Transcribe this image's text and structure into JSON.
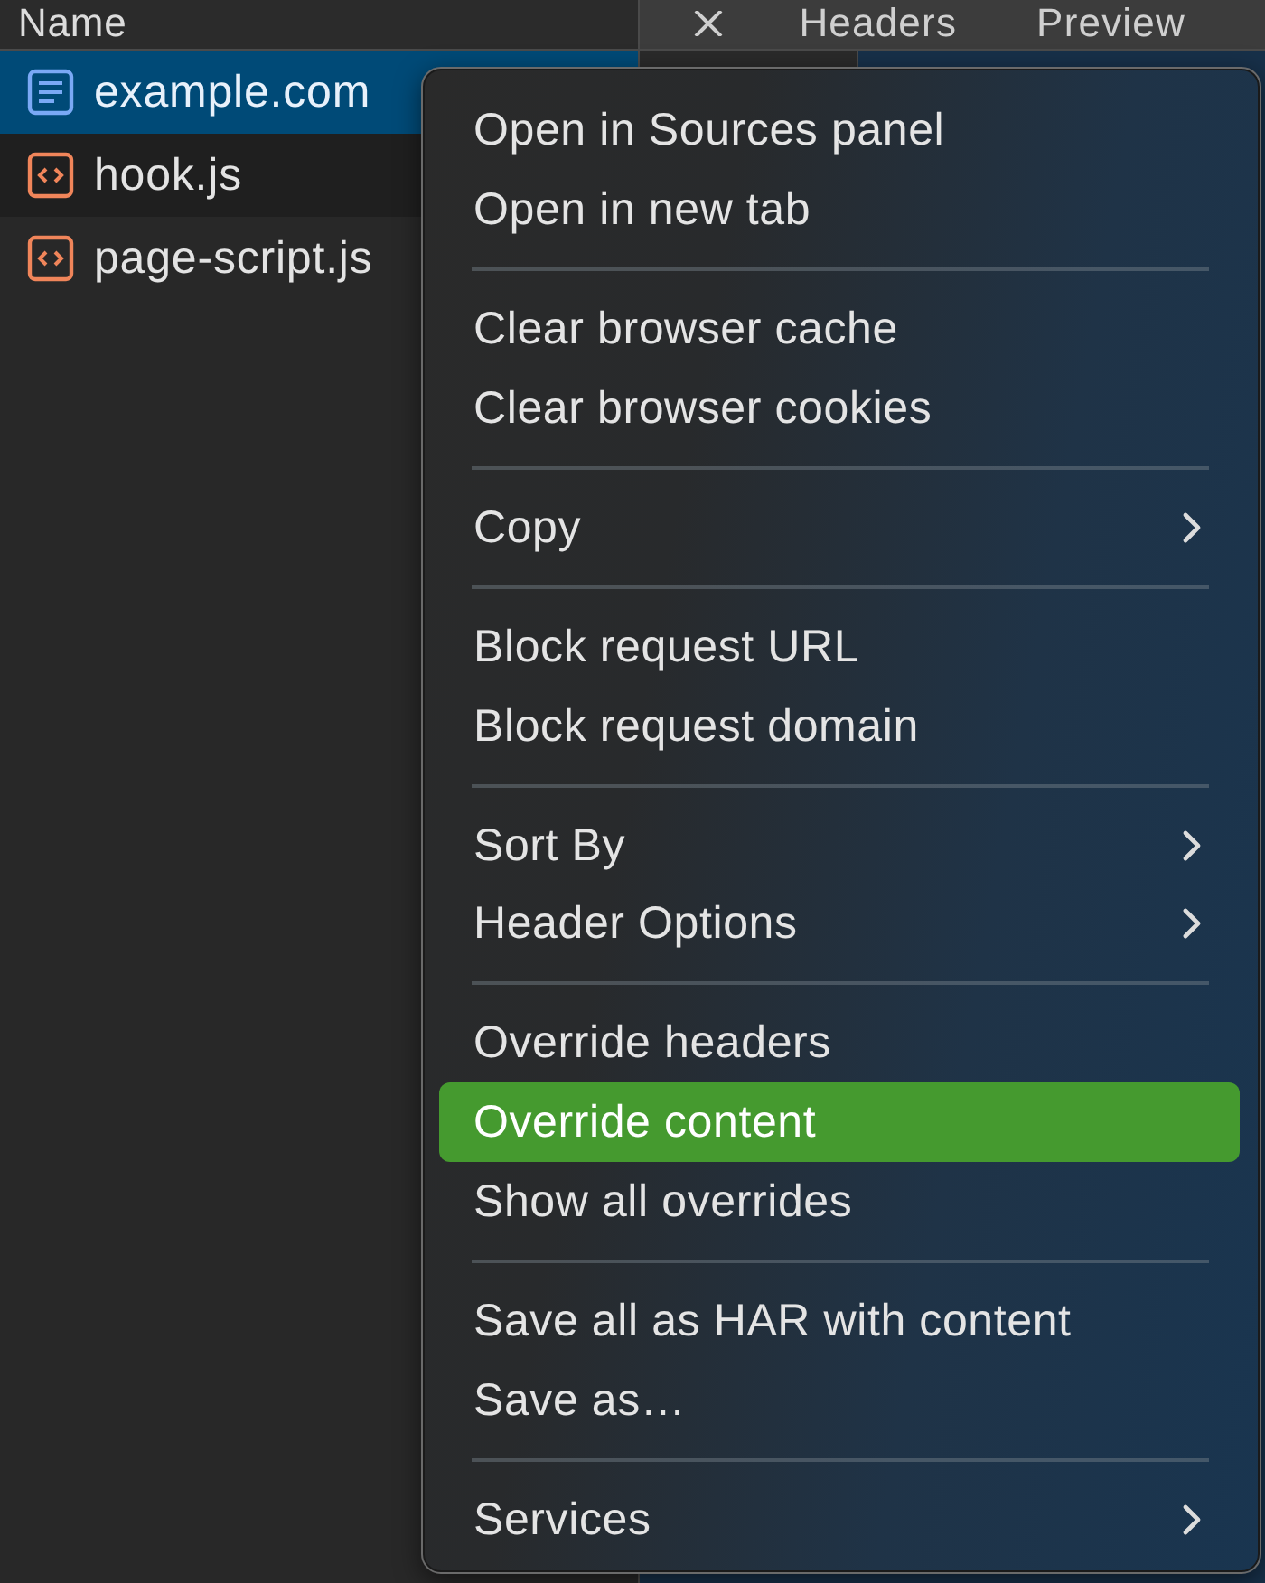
{
  "file_list": {
    "column": "Name",
    "rows": [
      {
        "name": "example.com",
        "kind": "document",
        "selected": true
      },
      {
        "name": "hook.js",
        "kind": "script",
        "selected": false
      },
      {
        "name": "page-script.js",
        "kind": "script",
        "selected": false
      }
    ]
  },
  "detail_tabs": [
    "Headers",
    "Preview"
  ],
  "context_menu": {
    "sections": [
      {
        "items": [
          {
            "label": "Open in Sources panel",
            "submenu": false,
            "highlighted": false
          },
          {
            "label": "Open in new tab",
            "submenu": false,
            "highlighted": false
          }
        ]
      },
      {
        "items": [
          {
            "label": "Clear browser cache",
            "submenu": false,
            "highlighted": false
          },
          {
            "label": "Clear browser cookies",
            "submenu": false,
            "highlighted": false
          }
        ]
      },
      {
        "items": [
          {
            "label": "Copy",
            "submenu": true,
            "highlighted": false
          }
        ]
      },
      {
        "items": [
          {
            "label": "Block request URL",
            "submenu": false,
            "highlighted": false
          },
          {
            "label": "Block request domain",
            "submenu": false,
            "highlighted": false
          }
        ]
      },
      {
        "items": [
          {
            "label": "Sort By",
            "submenu": true,
            "highlighted": false
          },
          {
            "label": "Header Options",
            "submenu": true,
            "highlighted": false
          }
        ]
      },
      {
        "items": [
          {
            "label": "Override headers",
            "submenu": false,
            "highlighted": false
          },
          {
            "label": "Override content",
            "submenu": false,
            "highlighted": true
          },
          {
            "label": "Show all overrides",
            "submenu": false,
            "highlighted": false
          }
        ]
      },
      {
        "items": [
          {
            "label": "Save all as HAR with content",
            "submenu": false,
            "highlighted": false
          },
          {
            "label": "Save as…",
            "submenu": false,
            "highlighted": false
          }
        ]
      },
      {
        "items": [
          {
            "label": "Services",
            "submenu": true,
            "highlighted": false
          }
        ]
      }
    ]
  }
}
